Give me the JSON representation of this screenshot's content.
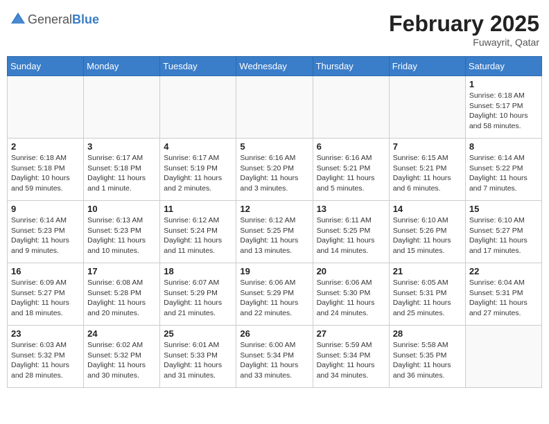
{
  "header": {
    "logo_general": "General",
    "logo_blue": "Blue",
    "month": "February 2025",
    "location": "Fuwayrit, Qatar"
  },
  "weekdays": [
    "Sunday",
    "Monday",
    "Tuesday",
    "Wednesday",
    "Thursday",
    "Friday",
    "Saturday"
  ],
  "weeks": [
    [
      {
        "day": "",
        "info": ""
      },
      {
        "day": "",
        "info": ""
      },
      {
        "day": "",
        "info": ""
      },
      {
        "day": "",
        "info": ""
      },
      {
        "day": "",
        "info": ""
      },
      {
        "day": "",
        "info": ""
      },
      {
        "day": "1",
        "info": "Sunrise: 6:18 AM\nSunset: 5:17 PM\nDaylight: 10 hours\nand 58 minutes."
      }
    ],
    [
      {
        "day": "2",
        "info": "Sunrise: 6:18 AM\nSunset: 5:18 PM\nDaylight: 10 hours\nand 59 minutes."
      },
      {
        "day": "3",
        "info": "Sunrise: 6:17 AM\nSunset: 5:18 PM\nDaylight: 11 hours\nand 1 minute."
      },
      {
        "day": "4",
        "info": "Sunrise: 6:17 AM\nSunset: 5:19 PM\nDaylight: 11 hours\nand 2 minutes."
      },
      {
        "day": "5",
        "info": "Sunrise: 6:16 AM\nSunset: 5:20 PM\nDaylight: 11 hours\nand 3 minutes."
      },
      {
        "day": "6",
        "info": "Sunrise: 6:16 AM\nSunset: 5:21 PM\nDaylight: 11 hours\nand 5 minutes."
      },
      {
        "day": "7",
        "info": "Sunrise: 6:15 AM\nSunset: 5:21 PM\nDaylight: 11 hours\nand 6 minutes."
      },
      {
        "day": "8",
        "info": "Sunrise: 6:14 AM\nSunset: 5:22 PM\nDaylight: 11 hours\nand 7 minutes."
      }
    ],
    [
      {
        "day": "9",
        "info": "Sunrise: 6:14 AM\nSunset: 5:23 PM\nDaylight: 11 hours\nand 9 minutes."
      },
      {
        "day": "10",
        "info": "Sunrise: 6:13 AM\nSunset: 5:23 PM\nDaylight: 11 hours\nand 10 minutes."
      },
      {
        "day": "11",
        "info": "Sunrise: 6:12 AM\nSunset: 5:24 PM\nDaylight: 11 hours\nand 11 minutes."
      },
      {
        "day": "12",
        "info": "Sunrise: 6:12 AM\nSunset: 5:25 PM\nDaylight: 11 hours\nand 13 minutes."
      },
      {
        "day": "13",
        "info": "Sunrise: 6:11 AM\nSunset: 5:25 PM\nDaylight: 11 hours\nand 14 minutes."
      },
      {
        "day": "14",
        "info": "Sunrise: 6:10 AM\nSunset: 5:26 PM\nDaylight: 11 hours\nand 15 minutes."
      },
      {
        "day": "15",
        "info": "Sunrise: 6:10 AM\nSunset: 5:27 PM\nDaylight: 11 hours\nand 17 minutes."
      }
    ],
    [
      {
        "day": "16",
        "info": "Sunrise: 6:09 AM\nSunset: 5:27 PM\nDaylight: 11 hours\nand 18 minutes."
      },
      {
        "day": "17",
        "info": "Sunrise: 6:08 AM\nSunset: 5:28 PM\nDaylight: 11 hours\nand 20 minutes."
      },
      {
        "day": "18",
        "info": "Sunrise: 6:07 AM\nSunset: 5:29 PM\nDaylight: 11 hours\nand 21 minutes."
      },
      {
        "day": "19",
        "info": "Sunrise: 6:06 AM\nSunset: 5:29 PM\nDaylight: 11 hours\nand 22 minutes."
      },
      {
        "day": "20",
        "info": "Sunrise: 6:06 AM\nSunset: 5:30 PM\nDaylight: 11 hours\nand 24 minutes."
      },
      {
        "day": "21",
        "info": "Sunrise: 6:05 AM\nSunset: 5:31 PM\nDaylight: 11 hours\nand 25 minutes."
      },
      {
        "day": "22",
        "info": "Sunrise: 6:04 AM\nSunset: 5:31 PM\nDaylight: 11 hours\nand 27 minutes."
      }
    ],
    [
      {
        "day": "23",
        "info": "Sunrise: 6:03 AM\nSunset: 5:32 PM\nDaylight: 11 hours\nand 28 minutes."
      },
      {
        "day": "24",
        "info": "Sunrise: 6:02 AM\nSunset: 5:32 PM\nDaylight: 11 hours\nand 30 minutes."
      },
      {
        "day": "25",
        "info": "Sunrise: 6:01 AM\nSunset: 5:33 PM\nDaylight: 11 hours\nand 31 minutes."
      },
      {
        "day": "26",
        "info": "Sunrise: 6:00 AM\nSunset: 5:34 PM\nDaylight: 11 hours\nand 33 minutes."
      },
      {
        "day": "27",
        "info": "Sunrise: 5:59 AM\nSunset: 5:34 PM\nDaylight: 11 hours\nand 34 minutes."
      },
      {
        "day": "28",
        "info": "Sunrise: 5:58 AM\nSunset: 5:35 PM\nDaylight: 11 hours\nand 36 minutes."
      },
      {
        "day": "",
        "info": ""
      }
    ]
  ]
}
